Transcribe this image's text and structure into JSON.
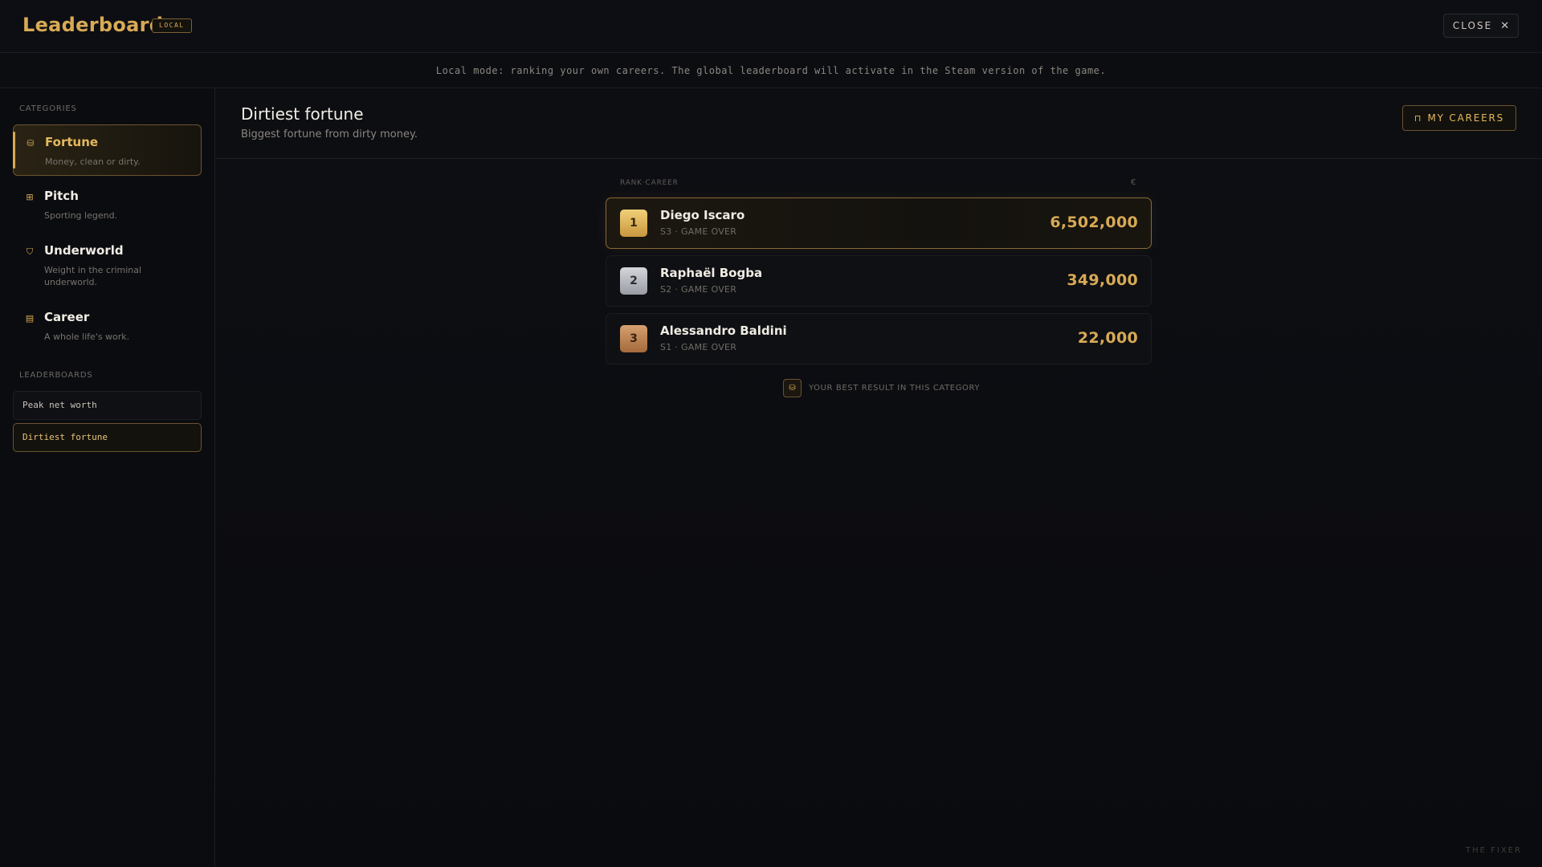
{
  "app": {
    "title": "Leaderboard",
    "mode_badge": "LOCAL",
    "close_label": "CLOSE",
    "close_icon": "close-icon",
    "footer_brand": "THE FIXER"
  },
  "notice": "Local mode: ranking your own careers. The global leaderboard will activate in the Steam version of the game.",
  "sidebar": {
    "categories_label": "CATEGORIES",
    "categories": [
      {
        "name": "Fortune",
        "desc": "Money, clean or dirty.",
        "icon": "coins-icon",
        "glyph": "⛁",
        "active": true
      },
      {
        "name": "Pitch",
        "desc": "Sporting legend.",
        "icon": "pitch-icon",
        "glyph": "⊞",
        "active": false
      },
      {
        "name": "Underworld",
        "desc": "Weight in the criminal underworld.",
        "icon": "shield-icon",
        "glyph": "⛉",
        "active": false
      },
      {
        "name": "Career",
        "desc": "A whole life's work.",
        "icon": "document-icon",
        "glyph": "▤",
        "active": false
      }
    ],
    "leaderboards_label": "LEADERBOARDS",
    "leaderboards": [
      {
        "label": "Peak net worth",
        "active": false
      },
      {
        "label": "Dirtiest fortune",
        "active": true
      }
    ]
  },
  "main": {
    "title": "Dirtiest fortune",
    "subtitle": "Biggest fortune from dirty money.",
    "my_careers_label": "MY CAREERS",
    "my_careers_icon": "briefcase-icon",
    "list_header_left": "RANK·CAREER",
    "list_header_right": "€",
    "rows": [
      {
        "rank": "1",
        "name": "Diego Iscaro",
        "meta": "S3 · GAME OVER",
        "value": "6,502,000",
        "medal": "gold"
      },
      {
        "rank": "2",
        "name": "Raphaël Bogba",
        "meta": "S2 · GAME OVER",
        "value": "349,000",
        "medal": "silver"
      },
      {
        "rank": "3",
        "name": "Alessandro Baldini",
        "meta": "S1 · GAME OVER",
        "value": "22,000",
        "medal": "bronze"
      }
    ],
    "legend_text": "YOUR BEST RESULT IN THIS CATEGORY",
    "legend_icon": "coins-icon"
  },
  "colors": {
    "accent": "#d8aa55",
    "background": "#0b0c10",
    "gold": "#e6c06a",
    "silver": "#c0c2c8",
    "bronze": "#c08454"
  }
}
